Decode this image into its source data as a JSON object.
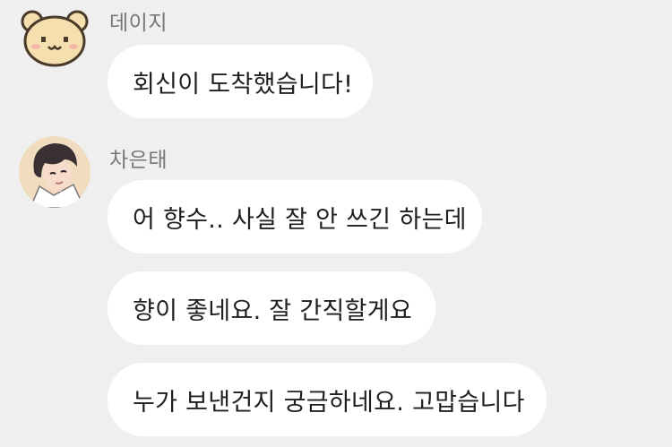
{
  "chat": {
    "messages": [
      {
        "sender": "데이지",
        "texts": [
          "회신이 도착했습니다!"
        ]
      },
      {
        "sender": "차은태",
        "texts": [
          "어 향수.. 사실 잘 안 쓰긴 하는데",
          "향이 좋네요. 잘 간직할게요",
          "누가 보낸건지 궁금하네요. 고맙습니다"
        ]
      }
    ]
  },
  "avatars": {
    "daisy_icon": "bear-face-avatar",
    "cha_icon": "person-portrait-avatar"
  },
  "colors": {
    "background": "#efefef",
    "bubble": "#ffffff",
    "sender_text": "#777777",
    "message_text": "#1f1f1f",
    "bear_fill": "#f6dfae",
    "bear_outline": "#4a3a2a"
  }
}
